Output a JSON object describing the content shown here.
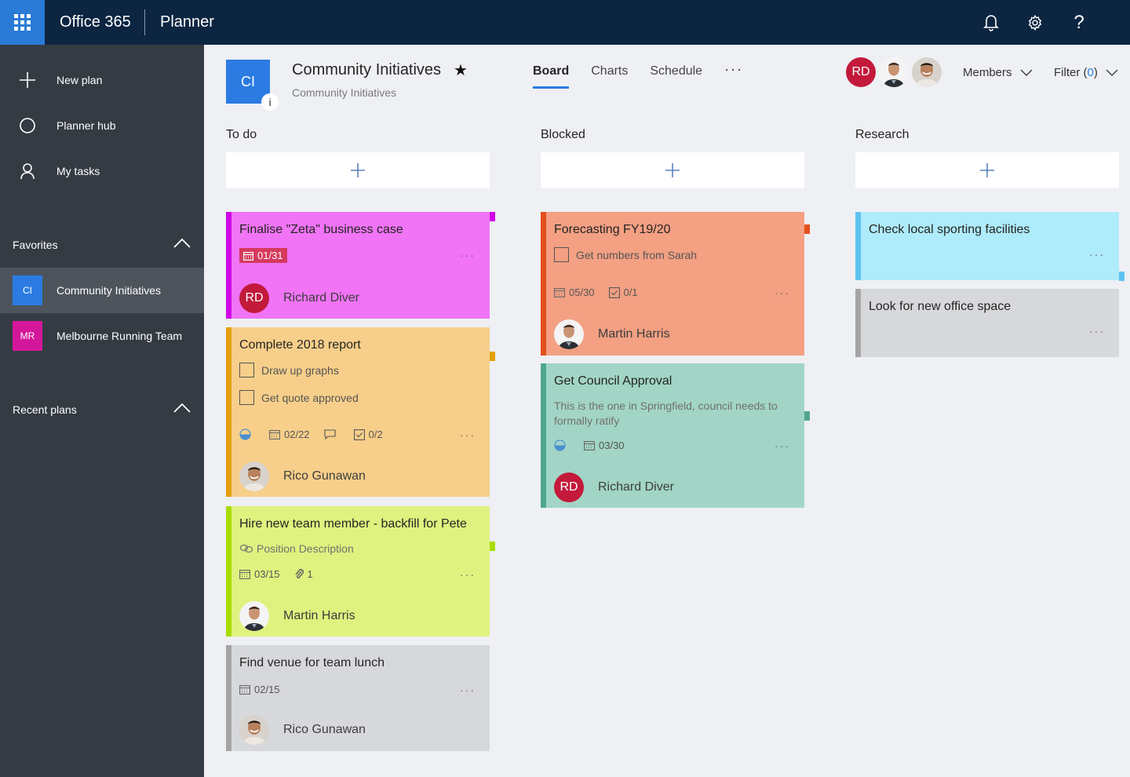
{
  "topbar": {
    "waffle_icon": "app-launcher-icon",
    "brand": "Office 365",
    "app_name": "Planner",
    "icons": [
      "bell-icon",
      "gear-icon",
      "help-icon"
    ],
    "help_glyph": "?"
  },
  "sidebar": {
    "nav": [
      {
        "label": "New plan",
        "icon": "plus-icon"
      },
      {
        "label": "Planner hub",
        "icon": "circle-icon"
      },
      {
        "label": "My tasks",
        "icon": "person-icon"
      }
    ],
    "favorites": {
      "label": "Favorites",
      "items": [
        {
          "initials": "CI",
          "label": "Community Initiatives",
          "color": "#2b7be3",
          "active": true
        },
        {
          "initials": "MR",
          "label": "Melbourne Running Team",
          "color": "#d4179a",
          "active": false
        }
      ]
    },
    "recent": {
      "label": "Recent plans"
    }
  },
  "plan": {
    "logo": "CI",
    "info_glyph": "i",
    "title": "Community Initiatives",
    "star": "★",
    "subtitle": "Community Initiatives"
  },
  "tabs": [
    {
      "label": "Board",
      "active": true
    },
    {
      "label": "Charts",
      "active": false
    },
    {
      "label": "Schedule",
      "active": false
    }
  ],
  "tabs_more": "···",
  "members": {
    "avatars": [
      {
        "type": "initials",
        "text": "RD",
        "name": "Richard Diver"
      },
      {
        "type": "photo",
        "name": "Martin Harris"
      },
      {
        "type": "photo",
        "name": "Rico Gunawan"
      }
    ],
    "label": "Members"
  },
  "filter": {
    "label": "Filter",
    "count_open": "(",
    "count": "0",
    "count_close": ")"
  },
  "colors": {
    "accent": "#2b7be3",
    "topbar": "#0c2541",
    "sidebar": "#343b43"
  },
  "buckets": [
    {
      "title": "To do",
      "tasks": [
        {
          "title": "Finalise \"Zeta\" business case",
          "color": "#f074f5",
          "bar": "#d000e8",
          "due": "01/31",
          "due_overdue": true,
          "assignee": "Richard Diver",
          "assignee_initials": "RD"
        },
        {
          "title": "Complete 2018 report",
          "color": "#f7cf8a",
          "bar": "#e3a006",
          "checklist": [
            "Draw up graphs",
            "Get quote approved"
          ],
          "progress": "in-progress",
          "due": "02/22",
          "has_comments": true,
          "checklist_count": "0/2",
          "assignee": "Rico Gunawan"
        },
        {
          "title": "Hire new team member - backfill for Pete",
          "color": "#dff27f",
          "bar": "#a8dc00",
          "link": "Position Description",
          "due": "03/15",
          "attachments": "1",
          "assignee": "Martin Harris"
        },
        {
          "title": "Find venue for team lunch",
          "color": "#d7d8db",
          "bar": "#a5a5a5",
          "due": "02/15",
          "assignee": "Rico Gunawan"
        }
      ]
    },
    {
      "title": "Blocked",
      "tasks": [
        {
          "title": "Forecasting FY19/20",
          "color": "#f3a083",
          "bar": "#e2501c",
          "checklist": [
            "Get numbers from Sarah"
          ],
          "due": "05/30",
          "checklist_count": "0/1",
          "assignee": "Martin Harris"
        },
        {
          "title": "Get Council Approval",
          "color": "#a2d5c6",
          "bar": "#4fa88b",
          "description": "This is the one in Springfield, council needs to formally ratify",
          "progress": "in-progress",
          "due": "03/30",
          "assignee": "Richard Diver",
          "assignee_initials": "RD"
        }
      ]
    },
    {
      "title": "Research",
      "tasks": [
        {
          "title": "Check local sporting facilities",
          "color": "#aeebfb",
          "bar": "#5fc3ef"
        },
        {
          "title": "Look for new office space",
          "color": "#d7d8db",
          "bar": "#a5a5a5"
        }
      ]
    }
  ],
  "more_glyph": "···"
}
